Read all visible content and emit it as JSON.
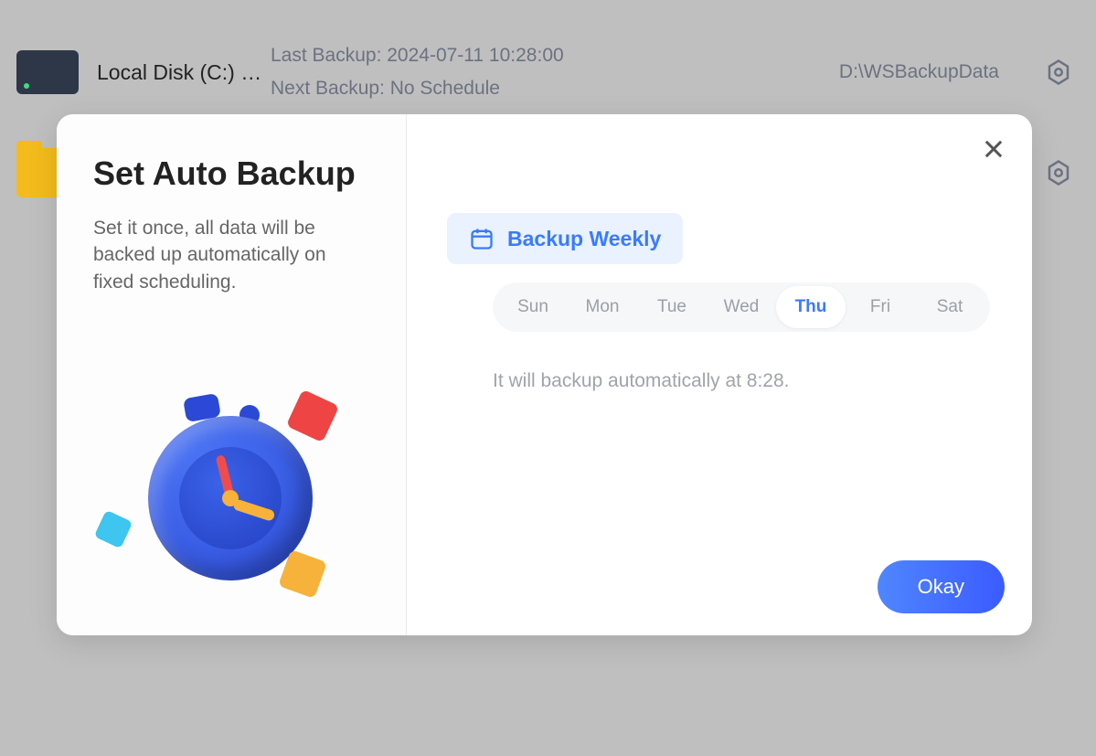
{
  "bg": {
    "rows": [
      {
        "title": "Local Disk (C:) …",
        "last": "Last Backup: 2024-07-11 10:28:00",
        "next": "Next Backup: No Schedule",
        "dest": "D:\\WSBackupData"
      }
    ]
  },
  "modal": {
    "title": "Set Auto Backup",
    "desc": "Set it once, all data will be backed up automatically on fixed scheduling.",
    "frequency": "Backup Weekly",
    "days": [
      "Sun",
      "Mon",
      "Tue",
      "Wed",
      "Thu",
      "Fri",
      "Sat"
    ],
    "active_day_index": 4,
    "schedule_text": "It will backup automatically at 8:28.",
    "okay": "Okay"
  }
}
